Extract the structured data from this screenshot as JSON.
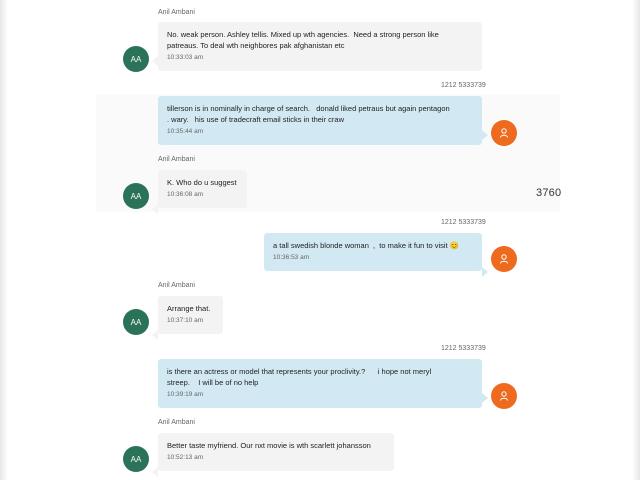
{
  "background": {
    "number_fragment": "3760"
  },
  "colors": {
    "incoming_bubble": "#f3f3f3",
    "outgoing_bubble": "#d2e9f3",
    "aa_avatar": "#2a7258",
    "user_avatar": "#ee6a1e"
  },
  "messages": [
    {
      "sender": "Anil Ambani",
      "text": "No. weak person. Ashley tellis. Mixed up wth agencies.  Need a strong person like\npatreaus. To deal wth neighbores pak afghanistan etc",
      "time": "10:33:03 am",
      "avatar": "AA"
    },
    {
      "sender": "1212 5333739",
      "text": "tillerson is in nominally in charge of search.   donald liked petraus but again pentagon\n. wary.   his use of tradecraft email sticks in their craw",
      "time": "10:35:44 am",
      "avatar": "person-icon"
    },
    {
      "sender": "Anil Ambani",
      "text": "K. Who do u suggest",
      "time": "10:36:08 am",
      "avatar": "AA"
    },
    {
      "sender": "1212 5333739",
      "text": "a tall swedish blonde woman  ,  to make it fun to visit 😊",
      "time": "10:36:53 am",
      "avatar": "person-icon"
    },
    {
      "sender": "Anil Ambani",
      "text": "Arrange that.",
      "time": "10:37:10 am",
      "avatar": "AA"
    },
    {
      "sender": "1212 5333739",
      "text": "is there an actress or model that represents your proclivity.?      i hope not meryl\nstreep.    I will be of no help",
      "time": "10:39:19 am",
      "avatar": "person-icon"
    },
    {
      "sender": "Anil Ambani",
      "text": "Better taste myfriend. Our nxt movie is wth scarlett johansson",
      "time": "10:52:13 am",
      "avatar": "AA"
    }
  ]
}
